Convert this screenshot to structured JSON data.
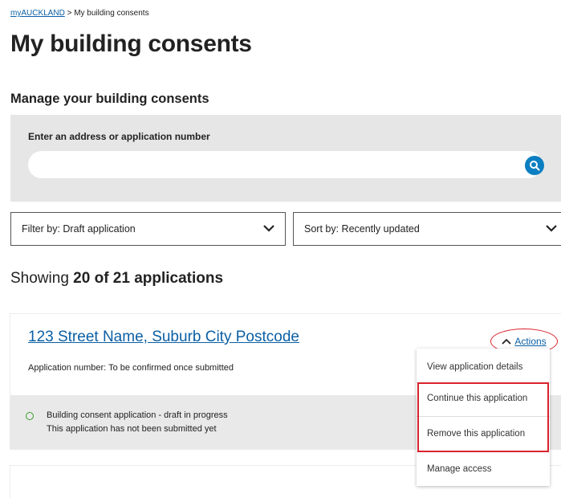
{
  "breadcrumb": {
    "home": "myAUCKLAND",
    "separator": ">",
    "current": "My building consents"
  },
  "page_title": "My building consents",
  "section_title": "Manage your building consents",
  "search": {
    "label": "Enter an address or application number",
    "value": "",
    "placeholder": ""
  },
  "filter": {
    "label": "Filter by: Draft application"
  },
  "sort": {
    "label": "Sort by: Recently updated"
  },
  "showing": {
    "prefix": "Showing",
    "count": "20 of 21 applications"
  },
  "application": {
    "address": "123 Street Name, Suburb City Postcode",
    "number_label": "Application number:",
    "number_value": "To be confirmed once submitted",
    "status_title": "Building consent application - draft in progress",
    "status_sub": "This application has not been submitted yet",
    "status_color": "#3a9a2e"
  },
  "actions": {
    "label": "Actions",
    "menu": [
      "View application details",
      "Continue this application",
      "Remove this application",
      "Manage access"
    ]
  },
  "colors": {
    "link": "#0b5fa5",
    "search_button": "#0c7ec2",
    "highlight": "#d9232e",
    "panel": "#e6e6e6"
  }
}
